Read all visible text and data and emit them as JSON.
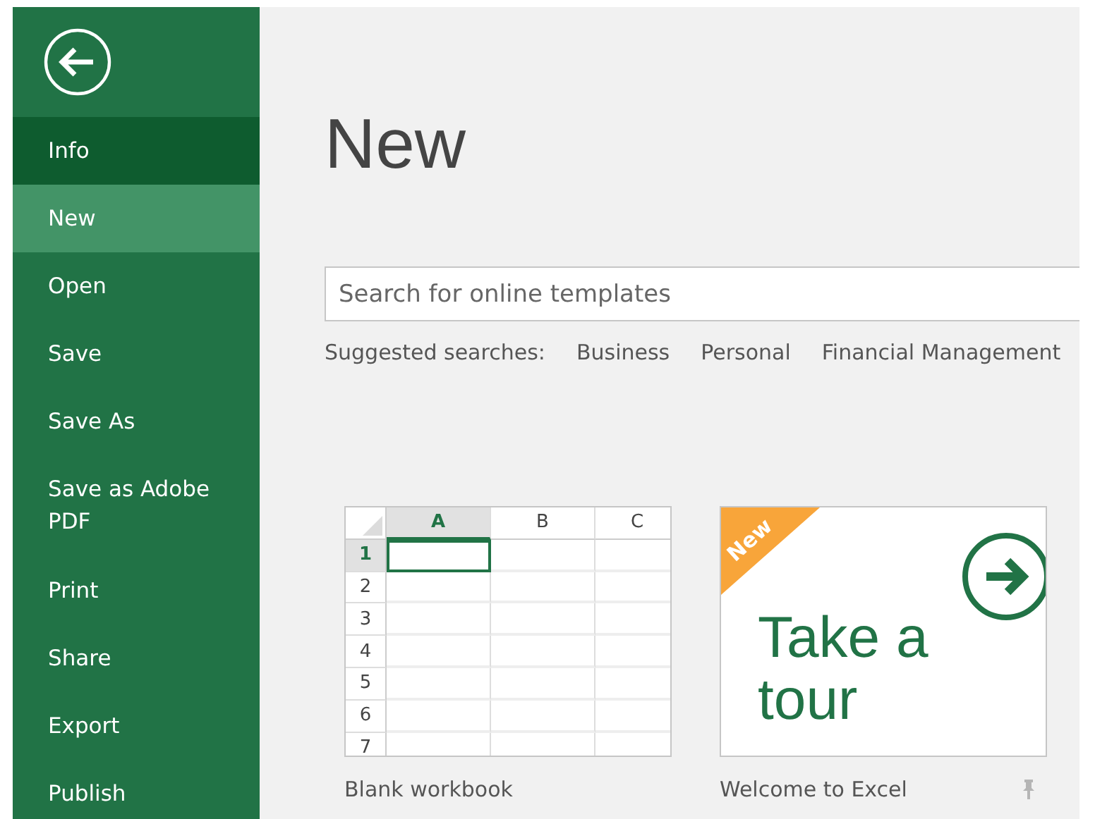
{
  "sidebar": {
    "items": [
      {
        "label": "Info",
        "selected": false,
        "highlighted": true
      },
      {
        "label": "New",
        "selected": true,
        "highlighted": false
      },
      {
        "label": "Open",
        "selected": false,
        "highlighted": false
      },
      {
        "label": "Save",
        "selected": false,
        "highlighted": false
      },
      {
        "label": "Save As",
        "selected": false,
        "highlighted": false
      },
      {
        "label": "Save as Adobe PDF",
        "selected": false,
        "highlighted": false
      },
      {
        "label": "Print",
        "selected": false,
        "highlighted": false
      },
      {
        "label": "Share",
        "selected": false,
        "highlighted": false
      },
      {
        "label": "Export",
        "selected": false,
        "highlighted": false
      },
      {
        "label": "Publish",
        "selected": false,
        "highlighted": false
      }
    ]
  },
  "title": "New",
  "search": {
    "placeholder": "Search for online templates"
  },
  "suggested": {
    "label": "Suggested searches:",
    "links": [
      "Business",
      "Personal",
      "Financial Management"
    ]
  },
  "templates": [
    {
      "kind": "workbook",
      "label": "Blank workbook",
      "columns": [
        "A",
        "B",
        "C"
      ],
      "rows": [
        "1",
        "2",
        "3",
        "4",
        "5",
        "6",
        "7"
      ]
    },
    {
      "kind": "tour",
      "label": "Welcome to Excel",
      "badge": "New",
      "lines": [
        "Take a",
        "tour"
      ],
      "pinned": true
    }
  ]
}
